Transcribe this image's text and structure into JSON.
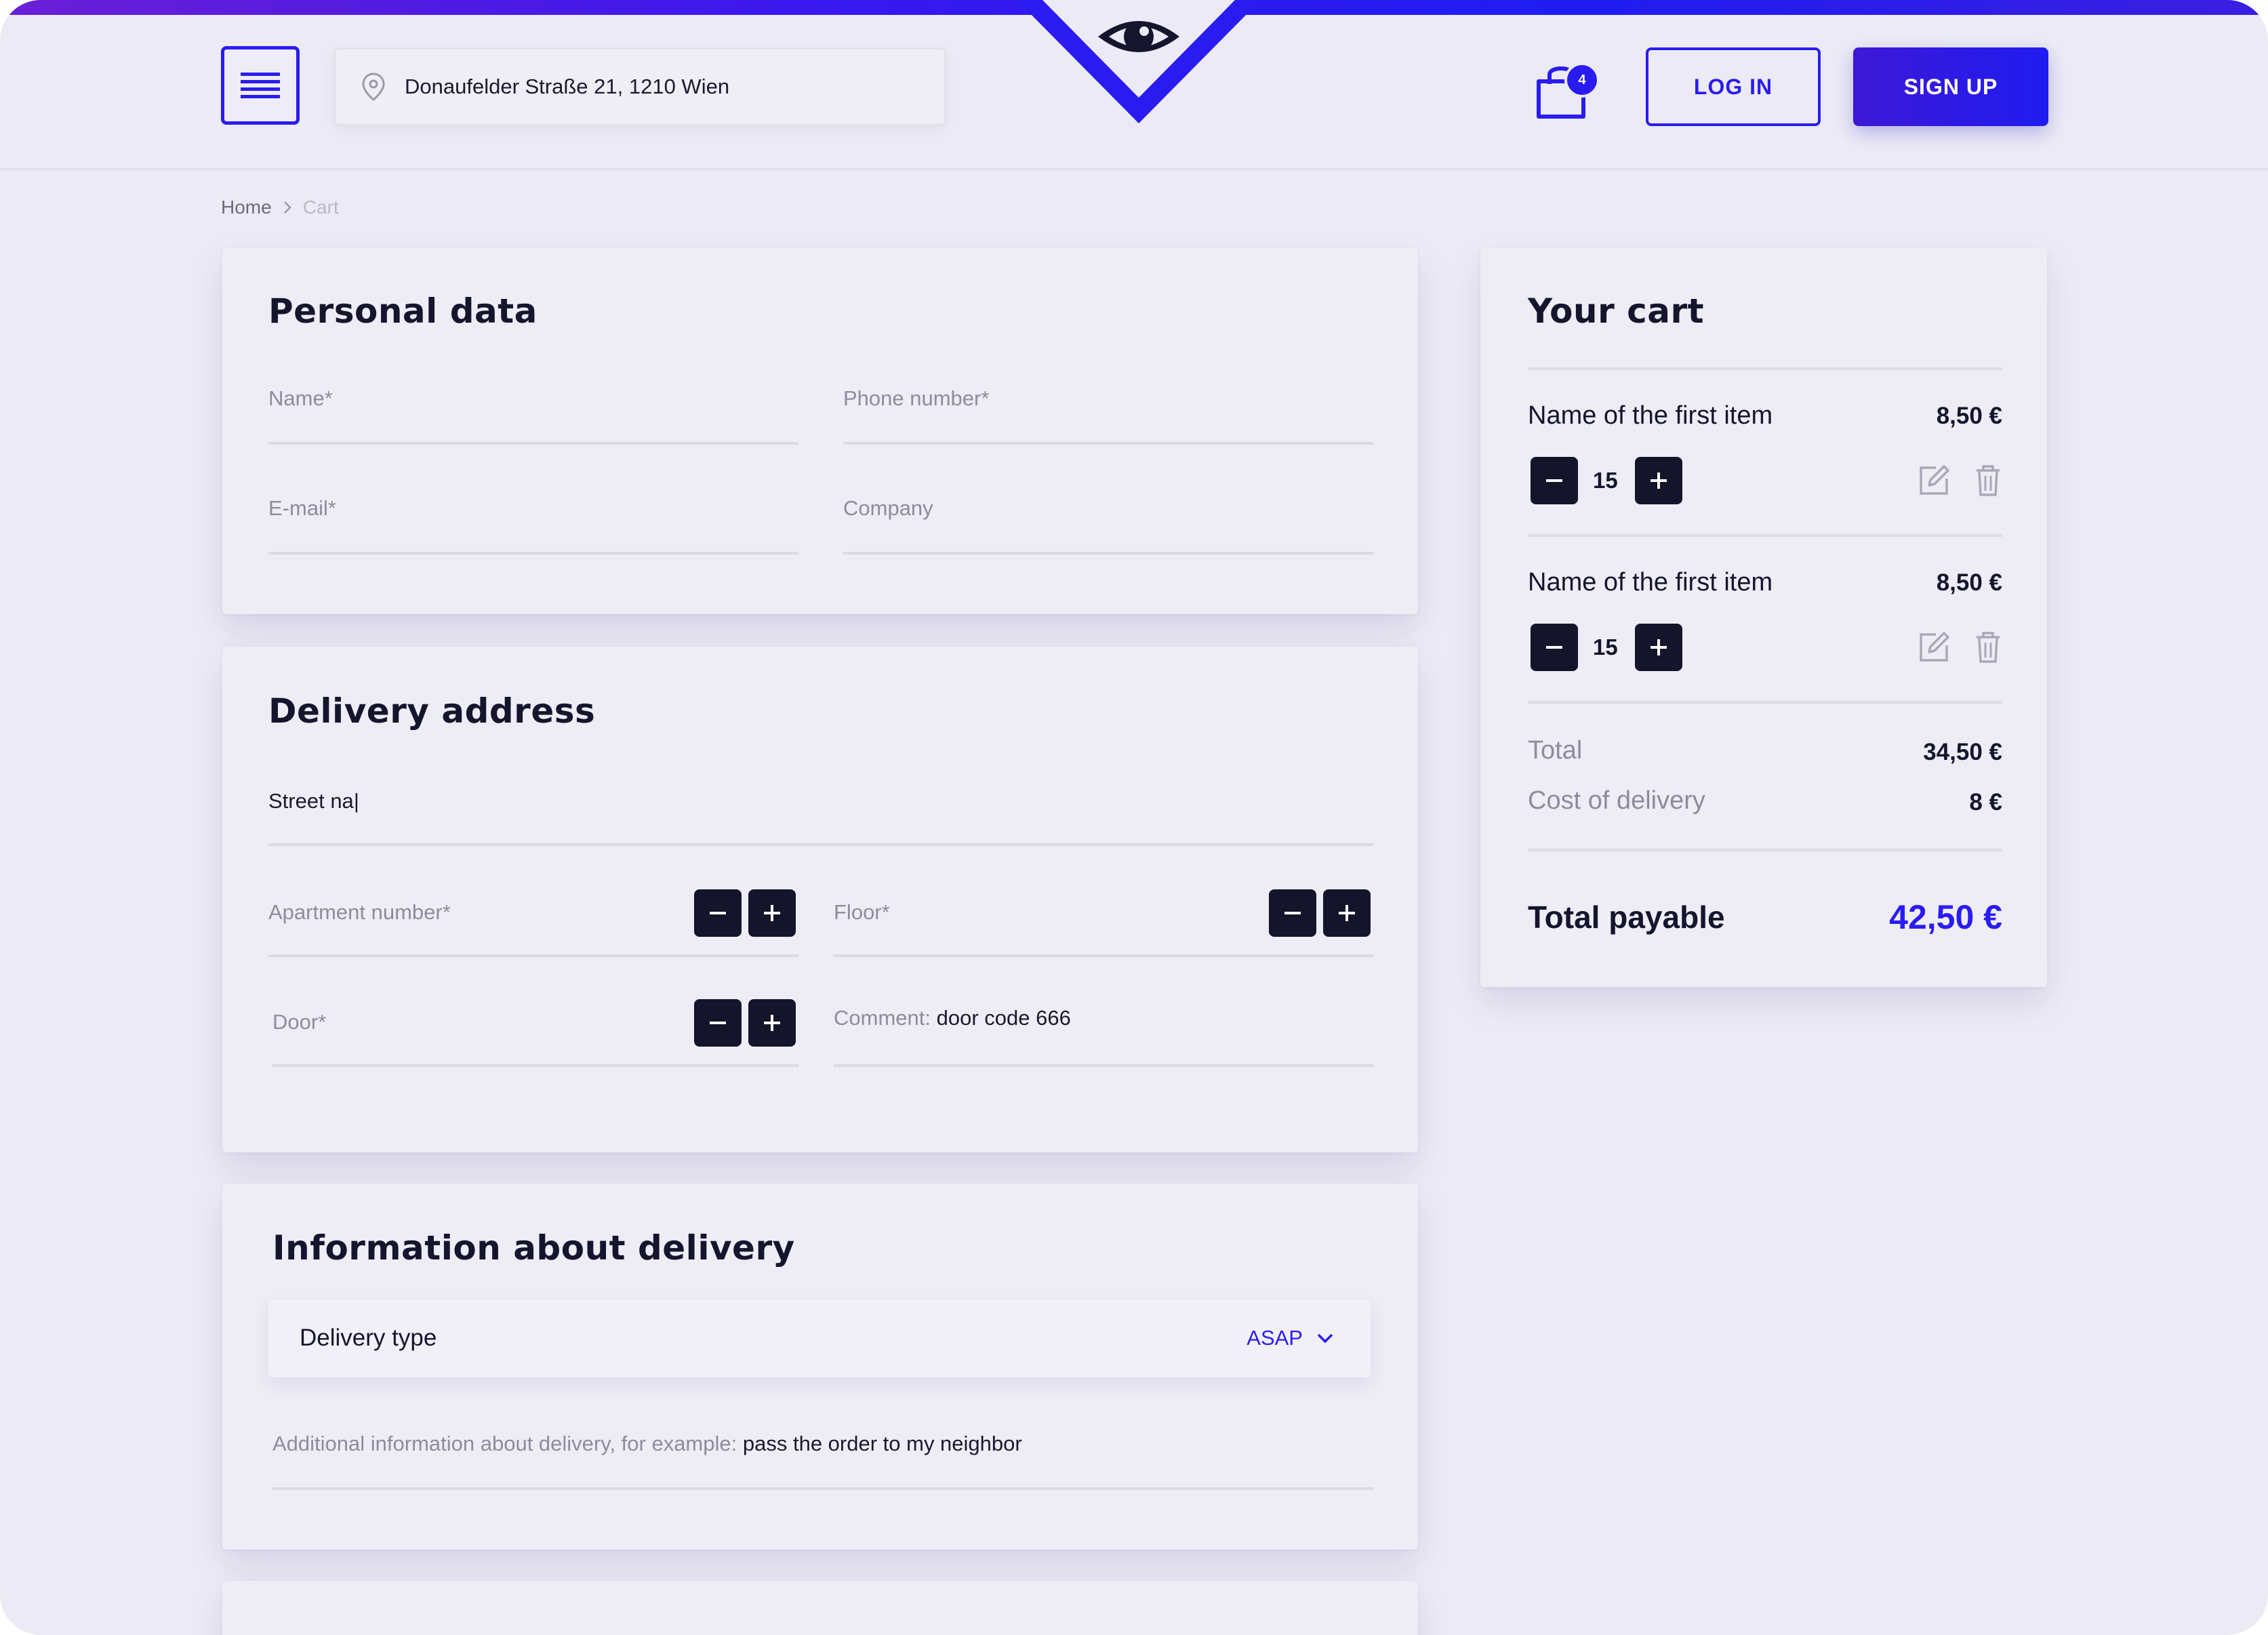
{
  "header": {
    "address": "Donaufelder Straße 21, 1210 Wien",
    "cart_count": "4",
    "login_label": "LOG IN",
    "signup_label": "SIGN UP"
  },
  "breadcrumb": {
    "items": [
      "Home",
      "Cart"
    ]
  },
  "personal_data": {
    "title": "Personal data",
    "name_placeholder": "Name*",
    "phone_placeholder": "Phone number*",
    "email_placeholder": "E-mail*",
    "company_placeholder": "Company"
  },
  "delivery_address": {
    "title": "Delivery address",
    "street_value": "Street na",
    "apartment_placeholder": "Apartment number*",
    "floor_placeholder": "Floor*",
    "door_placeholder": "Door*",
    "comment_label": "Comment:",
    "comment_value": "door code 666"
  },
  "delivery_info": {
    "title": "Information about delivery",
    "delivery_type_label": "Delivery type",
    "delivery_type_value": "ASAP",
    "additional_label": "Additional information about delivery, for example:",
    "additional_value": "pass the order to my neighbor"
  },
  "cart": {
    "title": "Your cart",
    "items": [
      {
        "name": "Name of the first item",
        "price": "8,50 €",
        "qty": "15"
      },
      {
        "name": "Name of the first item",
        "price": "8,50 €",
        "qty": "15"
      }
    ],
    "total_label": "Total",
    "total_value": "34,50 €",
    "delivery_cost_label": "Cost of delivery",
    "delivery_cost_value": "8 €",
    "payable_label": "Total payable",
    "payable_value": "42,50 €"
  },
  "colors": {
    "accent": "#2a1cf0",
    "dark": "#14142b",
    "background": "#ecebf5"
  },
  "icons": [
    "menu-icon",
    "location-pin-icon",
    "logo-eye-icon",
    "shopping-bag-icon",
    "chevron-right-icon",
    "minus-icon",
    "plus-icon",
    "edit-icon",
    "trash-icon",
    "chevron-down-icon"
  ]
}
